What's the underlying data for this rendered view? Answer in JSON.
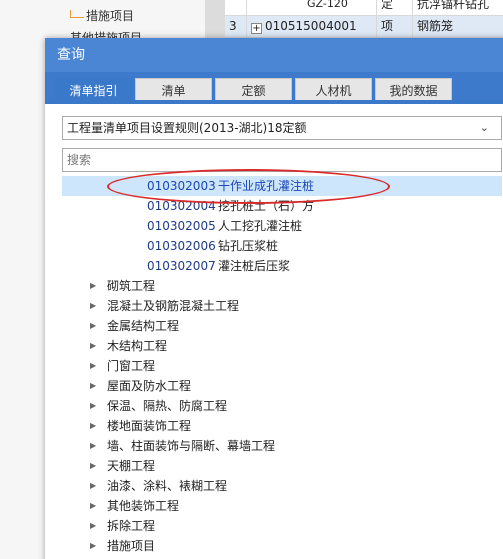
{
  "background": {
    "left_tree": [
      {
        "label": "措施项目"
      },
      {
        "label": "其他措施项目"
      }
    ],
    "grid_rows": [
      {
        "num": "",
        "code": "GZ-120",
        "type": "定",
        "name": "抗浮锚杆钻孔"
      },
      {
        "num": "3",
        "code": "010515004001",
        "type": "项",
        "name": "钢筋笼"
      }
    ]
  },
  "dialog": {
    "title": "查询",
    "tabs": [
      {
        "label": "清单指引",
        "active": true
      },
      {
        "label": "清单",
        "active": false
      },
      {
        "label": "定额",
        "active": false
      },
      {
        "label": "人材机",
        "active": false
      },
      {
        "label": "我的数据",
        "active": false
      }
    ],
    "select": {
      "value": "工程量清单项目设置规则(2013-湖北)18定额"
    },
    "search": {
      "placeholder": "搜索"
    },
    "items": [
      {
        "code": "010302003",
        "name": "干作业成孔灌注桩",
        "selected": true
      },
      {
        "code": "010302004",
        "name": "挖孔桩土（石）方",
        "selected": false
      },
      {
        "code": "010302005",
        "name": "人工挖孔灌注桩",
        "selected": false
      },
      {
        "code": "010302006",
        "name": "钻孔压浆桩",
        "selected": false
      },
      {
        "code": "010302007",
        "name": "灌注桩后压浆",
        "selected": false
      }
    ],
    "categories": [
      "砌筑工程",
      "混凝土及钢筋混凝土工程",
      "金属结构工程",
      "木结构工程",
      "门窗工程",
      "屋面及防水工程",
      "保温、隔热、防腐工程",
      "楼地面装饰工程",
      "墙、柱面装饰与隔断、幕墙工程",
      "天棚工程",
      "油漆、涂料、裱糊工程",
      "其他装饰工程",
      "拆除工程",
      "措施项目"
    ]
  },
  "colors": {
    "titlebar": "#4a86d4",
    "tab_active": "#3a78c9",
    "selection": "#cde6fb",
    "annotation": "#d92b2b"
  }
}
